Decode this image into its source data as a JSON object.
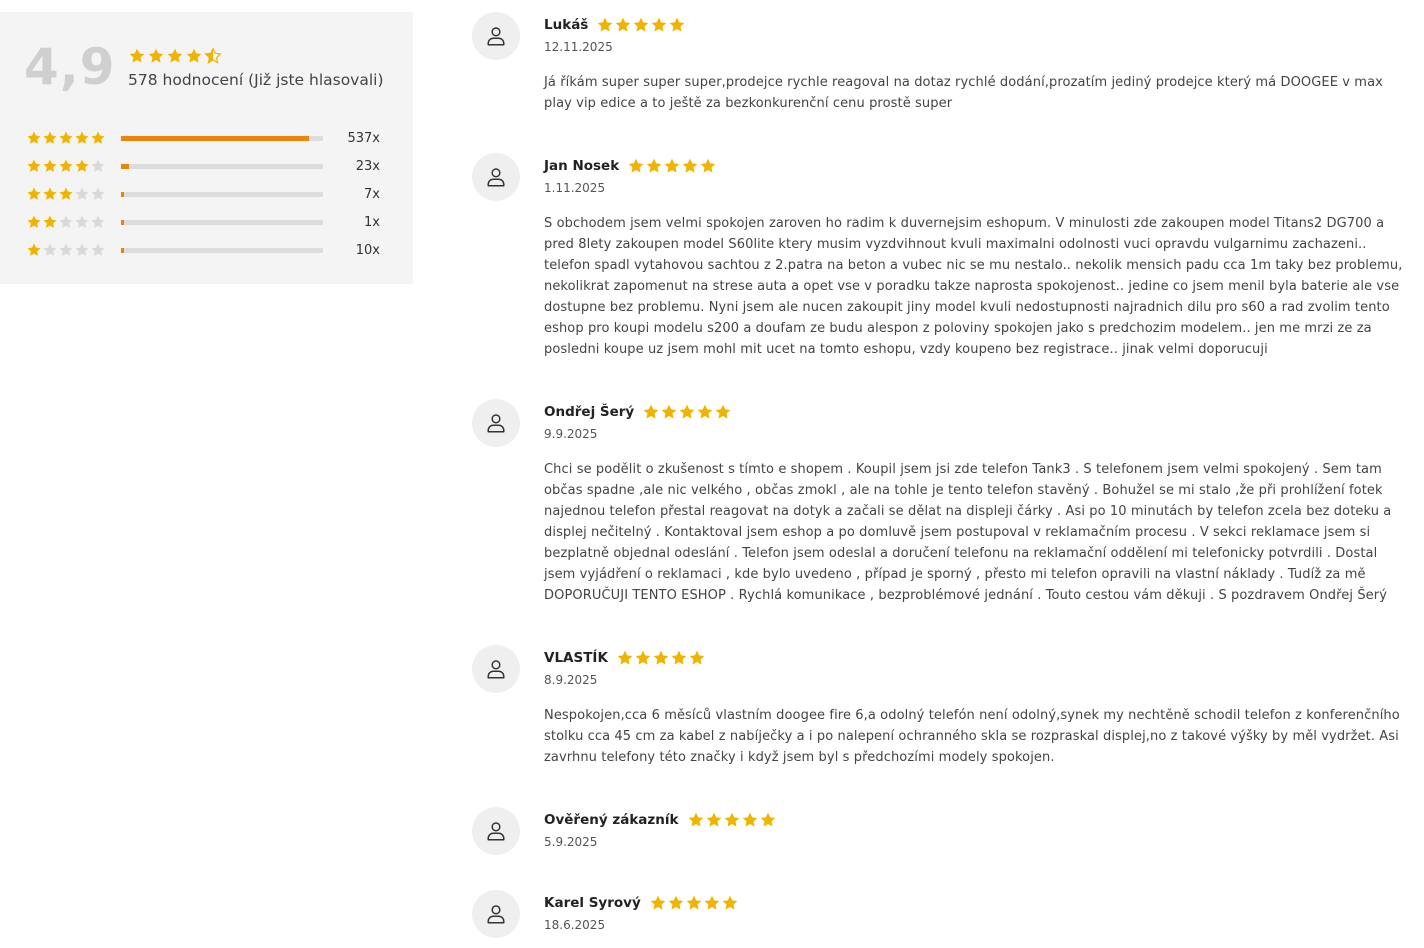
{
  "summary": {
    "average": "4,9",
    "average_stars": 4.5,
    "count_text": "578 hodnocení (Již jste hlasovali)",
    "distribution": [
      {
        "stars": 5,
        "count": "537x",
        "fraction": 0.93
      },
      {
        "stars": 4,
        "count": "23x",
        "fraction": 0.04
      },
      {
        "stars": 3,
        "count": "7x",
        "fraction": 0.012
      },
      {
        "stars": 2,
        "count": "1x",
        "fraction": 0.002
      },
      {
        "stars": 1,
        "count": "10x",
        "fraction": 0.017
      }
    ]
  },
  "colors": {
    "star_gold": "#f0b400",
    "star_empty": "#d9d9d9",
    "bar_fill": "#e9850c",
    "bar_track": "#dcdcdc",
    "summary_bg": "#f4f4f4",
    "avatar_bg": "#efefef"
  },
  "icons": {
    "avatar": "user-outline-icon",
    "star": "star-icon"
  },
  "reviews": [
    {
      "name": "Lukáš",
      "rating": 5,
      "date": "12.11.2025",
      "text": "Já říkám super super super,prodejce rychle reagoval na dotaz rychlé dodání,prozatím jediný prodejce který má DOOGEE v max play vip edice a to ještě za bezkonkurenční cenu prostě super"
    },
    {
      "name": "Jan Nosek",
      "rating": 5,
      "date": "1.11.2025",
      "text": "S obchodem jsem velmi spokojen zaroven ho radim k duvernejsim eshopum. V minulosti zde zakoupen model Titans2 DG700 a pred 8lety zakoupen model S60lite ktery musim vyzdvihnout kvuli maximalni odolnosti vuci opravdu vulgarnimu zachazeni.. telefon spadl vytahovou sachtou z 2.patra na beton a vubec nic se mu nestalo.. nekolik mensich padu cca 1m taky bez problemu, nekolikrat zapomenut na strese auta a opet vse v poradku takze naprosta spokojenost.. jedine co jsem menil byla baterie ale vse dostupne bez problemu. Nyni jsem ale nucen zakoupit jiny model kvuli nedostupnosti najradnich dilu pro s60 a rad zvolim tento eshop pro koupi modelu s200 a doufam ze budu alespon z poloviny spokojen jako s predchozim modelem.. jen me mrzi ze za posledni koupe uz jsem mohl mit ucet na tomto eshopu, vzdy koupeno bez registrace.. jinak velmi doporucuji"
    },
    {
      "name": "Ondřej Šerý",
      "rating": 5,
      "date": "9.9.2025",
      "text": "Chci se podělit o zkušenost s tímto e shopem . Koupil jsem jsi zde telefon Tank3 . S telefonem jsem velmi spokojený . Sem tam občas spadne ,ale nic velkého , občas zmokl , ale na tohle je tento telefon stavěný . Bohužel se mi stalo ,že při prohlížení fotek najednou telefon přestal reagovat na dotyk a začali se dělat na displeji čárky . Asi po 10 minutách by telefon zcela bez doteku a displej nečitelný . Kontaktoval jsem eshop a po domluvě jsem postupoval v reklamačním procesu . V sekci reklamace jsem si bezplatně objednal odeslání . Telefon jsem odeslal a doručení telefonu na reklamační oddělení mi telefonicky potvrdili . Dostal jsem vyjádření o reklamaci , kde bylo uvedeno , případ je sporný , přesto mi telefon opravili na vlastní náklady . Tudíž za mě DOPORUČUJI TENTO ESHOP . Rychlá komunikace , bezproblémové jednání . Touto cestou vám děkuji . S pozdravem Ondřej Šerý"
    },
    {
      "name": "VLASTÍK",
      "rating": 5,
      "date": "8.9.2025",
      "text": "Nespokojen,cca 6 měsíců vlastním doogee fire 6,a odolný telefón není odolný,synek my nechtěně schodil telefon z konferenčního stolku cca 45 cm za kabel z nabíječky a i po nalepení ochranného skla se rozpraskal displej,no z takové výšky by měl vydržet. Asi zavrhnu telefony této značky i když jsem byl s předchozími modely spokojen."
    },
    {
      "name": "Ověřený zákazník",
      "rating": 5,
      "date": "5.9.2025",
      "text": ""
    },
    {
      "name": "Karel Syrový",
      "rating": 5,
      "date": "18.6.2025",
      "text": ""
    }
  ]
}
